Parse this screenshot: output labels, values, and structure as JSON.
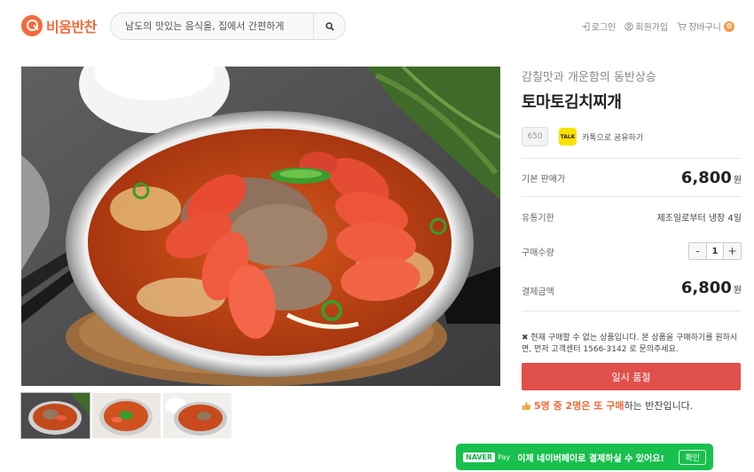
{
  "header": {
    "logo_text": "비움반찬",
    "search_placeholder": "남도의 맛있는 음식을, 집에서 간편하게",
    "nav": {
      "login": "로그인",
      "signup": "회원가입",
      "cart": "장바구니",
      "cart_count": "0"
    }
  },
  "product": {
    "subtitle": "감칠맛과 개운함의 동반상승",
    "title": "토마토김치찌개",
    "view_count": "650",
    "share_label": "카톡으로 공유하기",
    "kakao_badge": "TALK",
    "base_price_label": "기본 판매가",
    "base_price": "6,800",
    "currency": "원",
    "shelf_life_label": "유통기한",
    "shelf_life": "제조일로부터 냉장 4일",
    "quantity_label": "구매수량",
    "quantity": "1",
    "minus": "-",
    "plus": "+",
    "total_label": "결제금액",
    "total_price": "6,800",
    "notice_mark": "✖",
    "notice": "현재 구매할 수 없는 상품입니다. 본 상품을 구매하기를 원하시면, 먼저 고객센터 1566-3142 로 문의주세요.",
    "soldout_button": "일시 품절",
    "buy_stat_prefix": "5명 중 2명은 또 구매",
    "buy_stat_suffix": "하는 반찬입니다."
  },
  "naverpay": {
    "badge": "NAVER",
    "pay": "Pay",
    "message": "이제 네이버페이로 결제하실 수 있어요!",
    "confirm": "확인"
  },
  "colors": {
    "brand": "#f26b3a",
    "soldout": "#e0504a",
    "naverpay": "#18c04d",
    "kakao": "#fae100"
  }
}
